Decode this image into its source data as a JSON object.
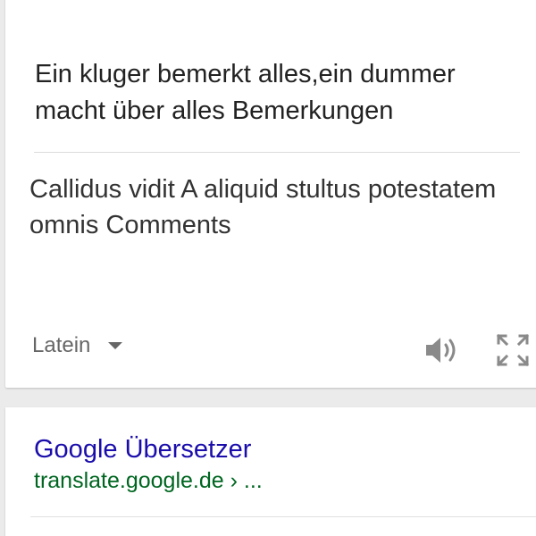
{
  "translation_card": {
    "source_text": "Ein kluger bemerkt alles,ein dummer macht über alles Bemerkungen",
    "target_text": "Callidus vidit A aliquid stultus potestatem omnis Comments",
    "target_language": "Latein",
    "icons": {
      "dropdown": "caret-down-icon",
      "listen": "speaker-icon",
      "expand": "fullscreen-icon"
    }
  },
  "search_result": {
    "title": "Google Übersetzer",
    "url": "translate.google.de › ..."
  },
  "colors": {
    "link_blue": "#1a0dab",
    "url_green": "#006621",
    "text_dark": "#222222",
    "icon_gray": "#8a8a8a",
    "background": "#ebebeb"
  }
}
